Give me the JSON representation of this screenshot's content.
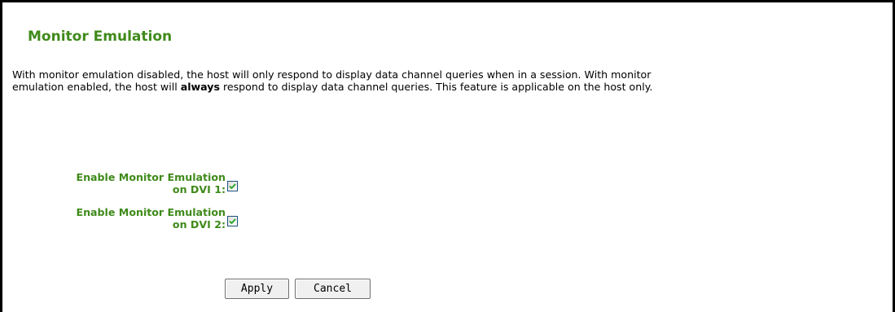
{
  "page": {
    "title": "Monitor Emulation",
    "description": {
      "part1": "With monitor emulation disabled, the host will only respond to display data channel queries when in a session. With monitor",
      "part2_pre": "emulation enabled, the host will ",
      "part2_bold": "always",
      "part2_post": " respond to display data channel queries. This feature is applicable on the host only."
    }
  },
  "settings": [
    {
      "label_line1": "Enable Monitor Emulation",
      "label_line2": "on DVI 1:",
      "checked": true
    },
    {
      "label_line1": "Enable Monitor Emulation",
      "label_line2": "on DVI 2:",
      "checked": true
    }
  ],
  "buttons": {
    "apply": "Apply",
    "cancel": "Cancel"
  },
  "colors": {
    "label_green": "#3f8a1a",
    "checkbox_border": "#1c5180",
    "checkmark_green": "#21a121",
    "frame_border": "#000000"
  }
}
